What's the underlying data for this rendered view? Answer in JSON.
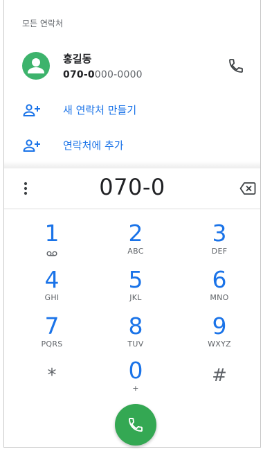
{
  "contacts_section": {
    "label": "모든 연락처"
  },
  "contact": {
    "name": "홍길동",
    "number_match": "070-0",
    "number_rest": "000-0000",
    "avatar_color": "#3db36c"
  },
  "actions": [
    {
      "label": "새 연락처 만들기",
      "icon": "add-person-icon"
    },
    {
      "label": "연락처에 추가",
      "icon": "add-person-icon"
    }
  ],
  "dialer": {
    "number": "070-0"
  },
  "keypad": [
    {
      "digit": "1",
      "letters": "",
      "icon": "voicemail-icon"
    },
    {
      "digit": "2",
      "letters": "ABC"
    },
    {
      "digit": "3",
      "letters": "DEF"
    },
    {
      "digit": "4",
      "letters": "GHI"
    },
    {
      "digit": "5",
      "letters": "JKL"
    },
    {
      "digit": "6",
      "letters": "MNO"
    },
    {
      "digit": "7",
      "letters": "PQRS"
    },
    {
      "digit": "8",
      "letters": "TUV"
    },
    {
      "digit": "9",
      "letters": "WXYZ"
    },
    {
      "digit": "*",
      "letters": ""
    },
    {
      "digit": "0",
      "letters": "+"
    },
    {
      "digit": "#",
      "letters": ""
    }
  ],
  "colors": {
    "accent": "#1a73e8",
    "call_button": "#34a853"
  }
}
